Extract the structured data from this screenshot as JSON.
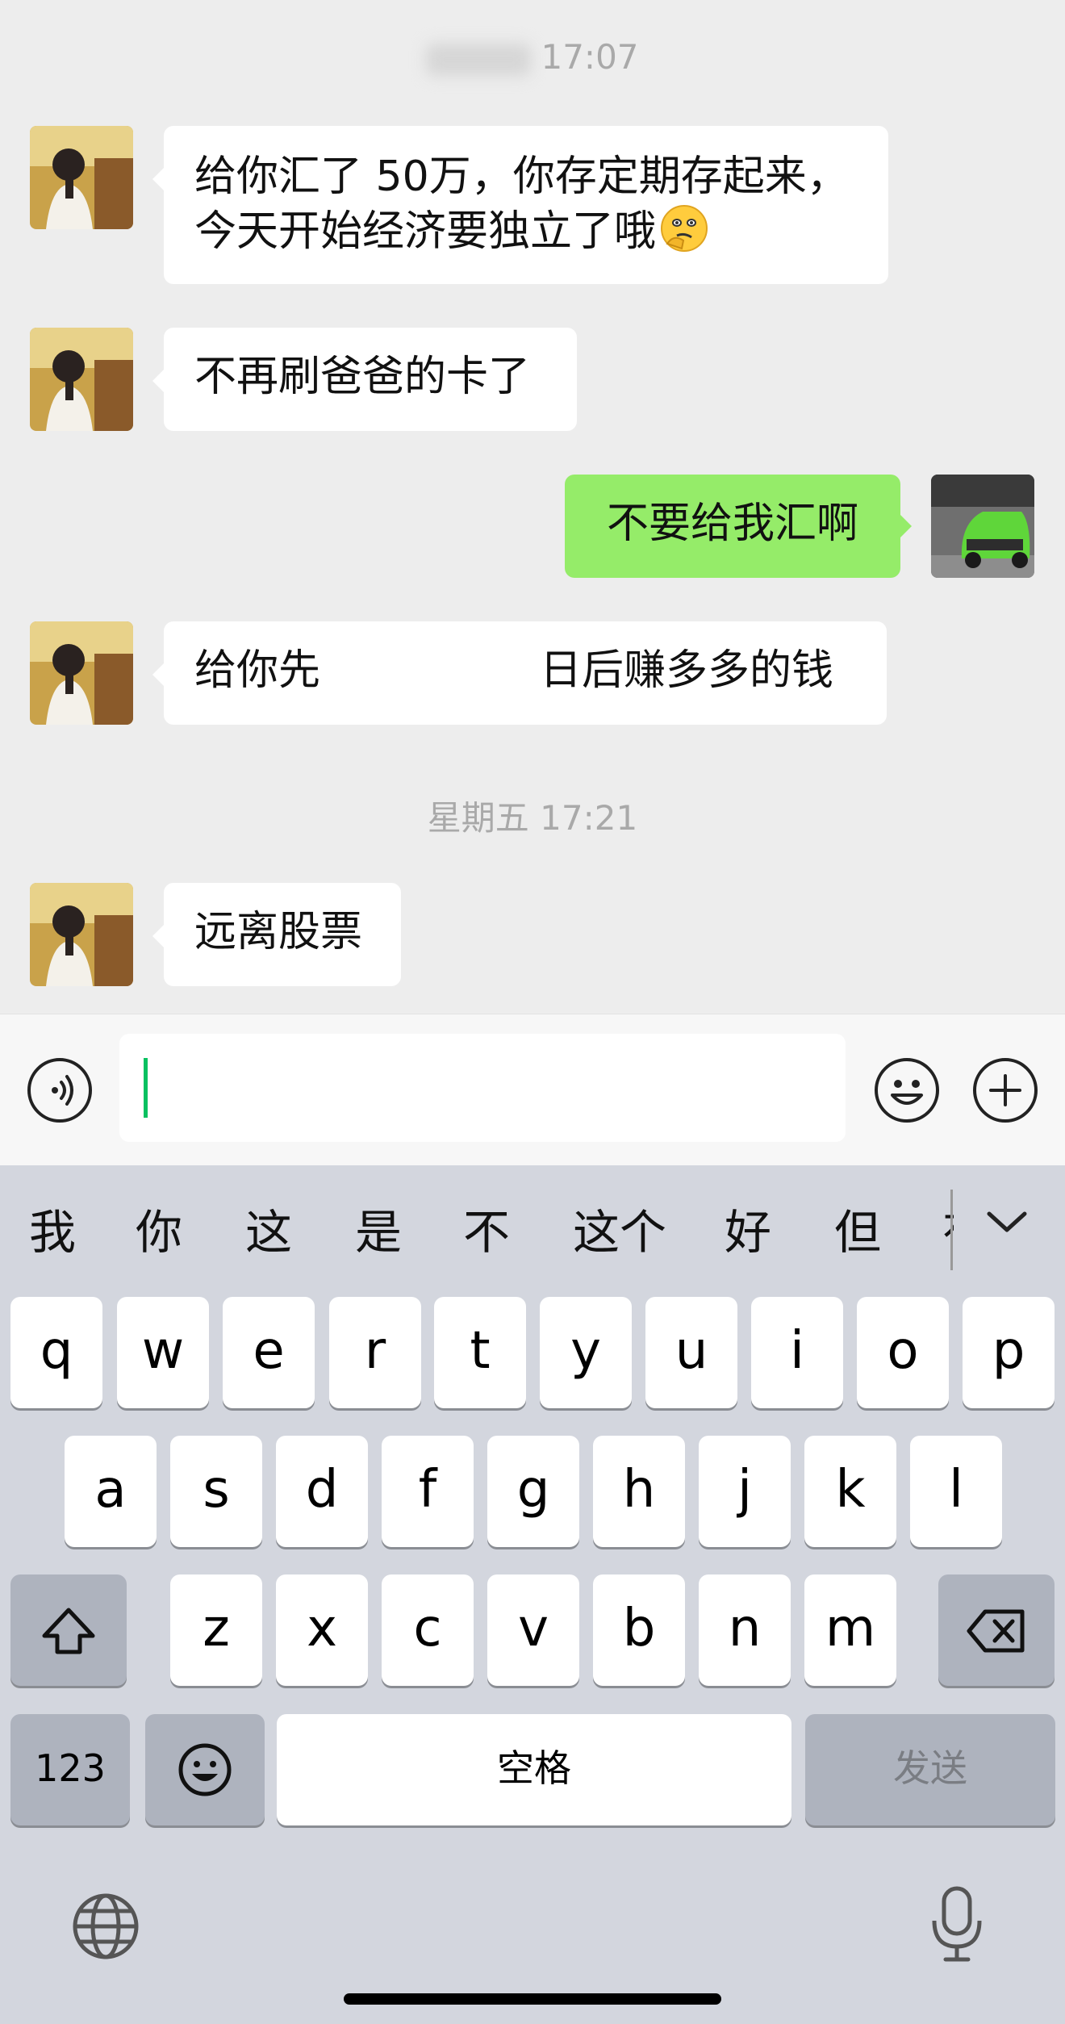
{
  "chat": {
    "timestamp_1": "17:07",
    "timestamp_2": "星期五 17:21",
    "messages": [
      {
        "side": "in",
        "line1": "给你汇了 50万，你存定期存起来，",
        "line2": "今天开始经济要独立了哦"
      },
      {
        "side": "in",
        "text": "不再刷爸爸的卡了"
      },
      {
        "side": "out",
        "text": "不要给我汇啊"
      },
      {
        "side": "in",
        "text_a": "给你先",
        "text_b": "日后赚多多的钱"
      },
      {
        "side": "in",
        "text": "远离股票"
      }
    ]
  },
  "input": {
    "value": ""
  },
  "keyboard": {
    "candidates": [
      "我",
      "你",
      "这",
      "是",
      "不",
      "这个",
      "好",
      "但",
      "有"
    ],
    "row1": [
      "q",
      "w",
      "e",
      "r",
      "t",
      "y",
      "u",
      "i",
      "o",
      "p"
    ],
    "row2": [
      "a",
      "s",
      "d",
      "f",
      "g",
      "h",
      "j",
      "k",
      "l"
    ],
    "row3": [
      "z",
      "x",
      "c",
      "v",
      "b",
      "n",
      "m"
    ],
    "numbers_key": "123",
    "space_key": "空格",
    "send_key": "发送"
  },
  "colors": {
    "outgoing_bubble": "#95ec69",
    "caret": "#07c160",
    "background": "#ededed"
  },
  "icons": [
    "voice-icon",
    "emoji-icon",
    "plus-icon",
    "collapse-chevron-icon",
    "shift-icon",
    "backspace-icon",
    "emoji-keyboard-icon",
    "globe-icon",
    "microphone-icon"
  ]
}
